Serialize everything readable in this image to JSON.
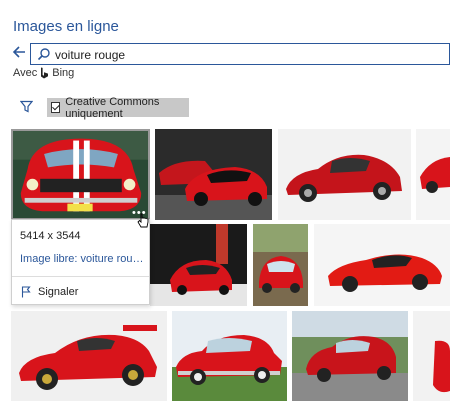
{
  "header": {
    "title": "Images en ligne"
  },
  "search": {
    "value": "voiture rouge"
  },
  "provider": {
    "prefix": "Avec",
    "name": "Bing"
  },
  "filter": {
    "label": "Creative Commons uniquement",
    "checked": true
  },
  "selected_image": {
    "dimensions": "5414 x 3544",
    "license_link": "Image libre: voiture rouge, b...",
    "report_label": "Signaler"
  },
  "colors": {
    "accent": "#2b579a",
    "car_red": "#d8141b"
  },
  "icons": [
    "back-arrow-icon",
    "search-icon",
    "bing-icon",
    "filter-icon",
    "checkbox-icon",
    "flag-icon",
    "more-icon",
    "cursor-icon"
  ]
}
